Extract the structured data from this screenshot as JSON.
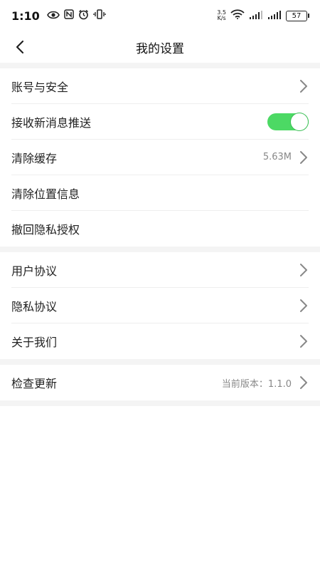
{
  "status_bar": {
    "time": "1:10",
    "net_speed_value": "3.5",
    "net_speed_unit": "K/s",
    "battery": "57"
  },
  "nav": {
    "title": "我的设置"
  },
  "sections": [
    {
      "rows": [
        {
          "label": "账号与安全"
        },
        {
          "label": "接收新消息推送",
          "toggle_on": true
        },
        {
          "label": "清除缓存",
          "value": "5.63M"
        },
        {
          "label": "清除位置信息"
        },
        {
          "label": "撤回隐私授权"
        }
      ]
    },
    {
      "rows": [
        {
          "label": "用户协议"
        },
        {
          "label": "隐私协议"
        },
        {
          "label": "关于我们"
        }
      ]
    },
    {
      "rows": [
        {
          "label": "检查更新",
          "value": "当前版本：1.1.0"
        }
      ]
    }
  ],
  "colors": {
    "toggle_on": "#4cd964",
    "section_gap": "#f4f4f4"
  }
}
